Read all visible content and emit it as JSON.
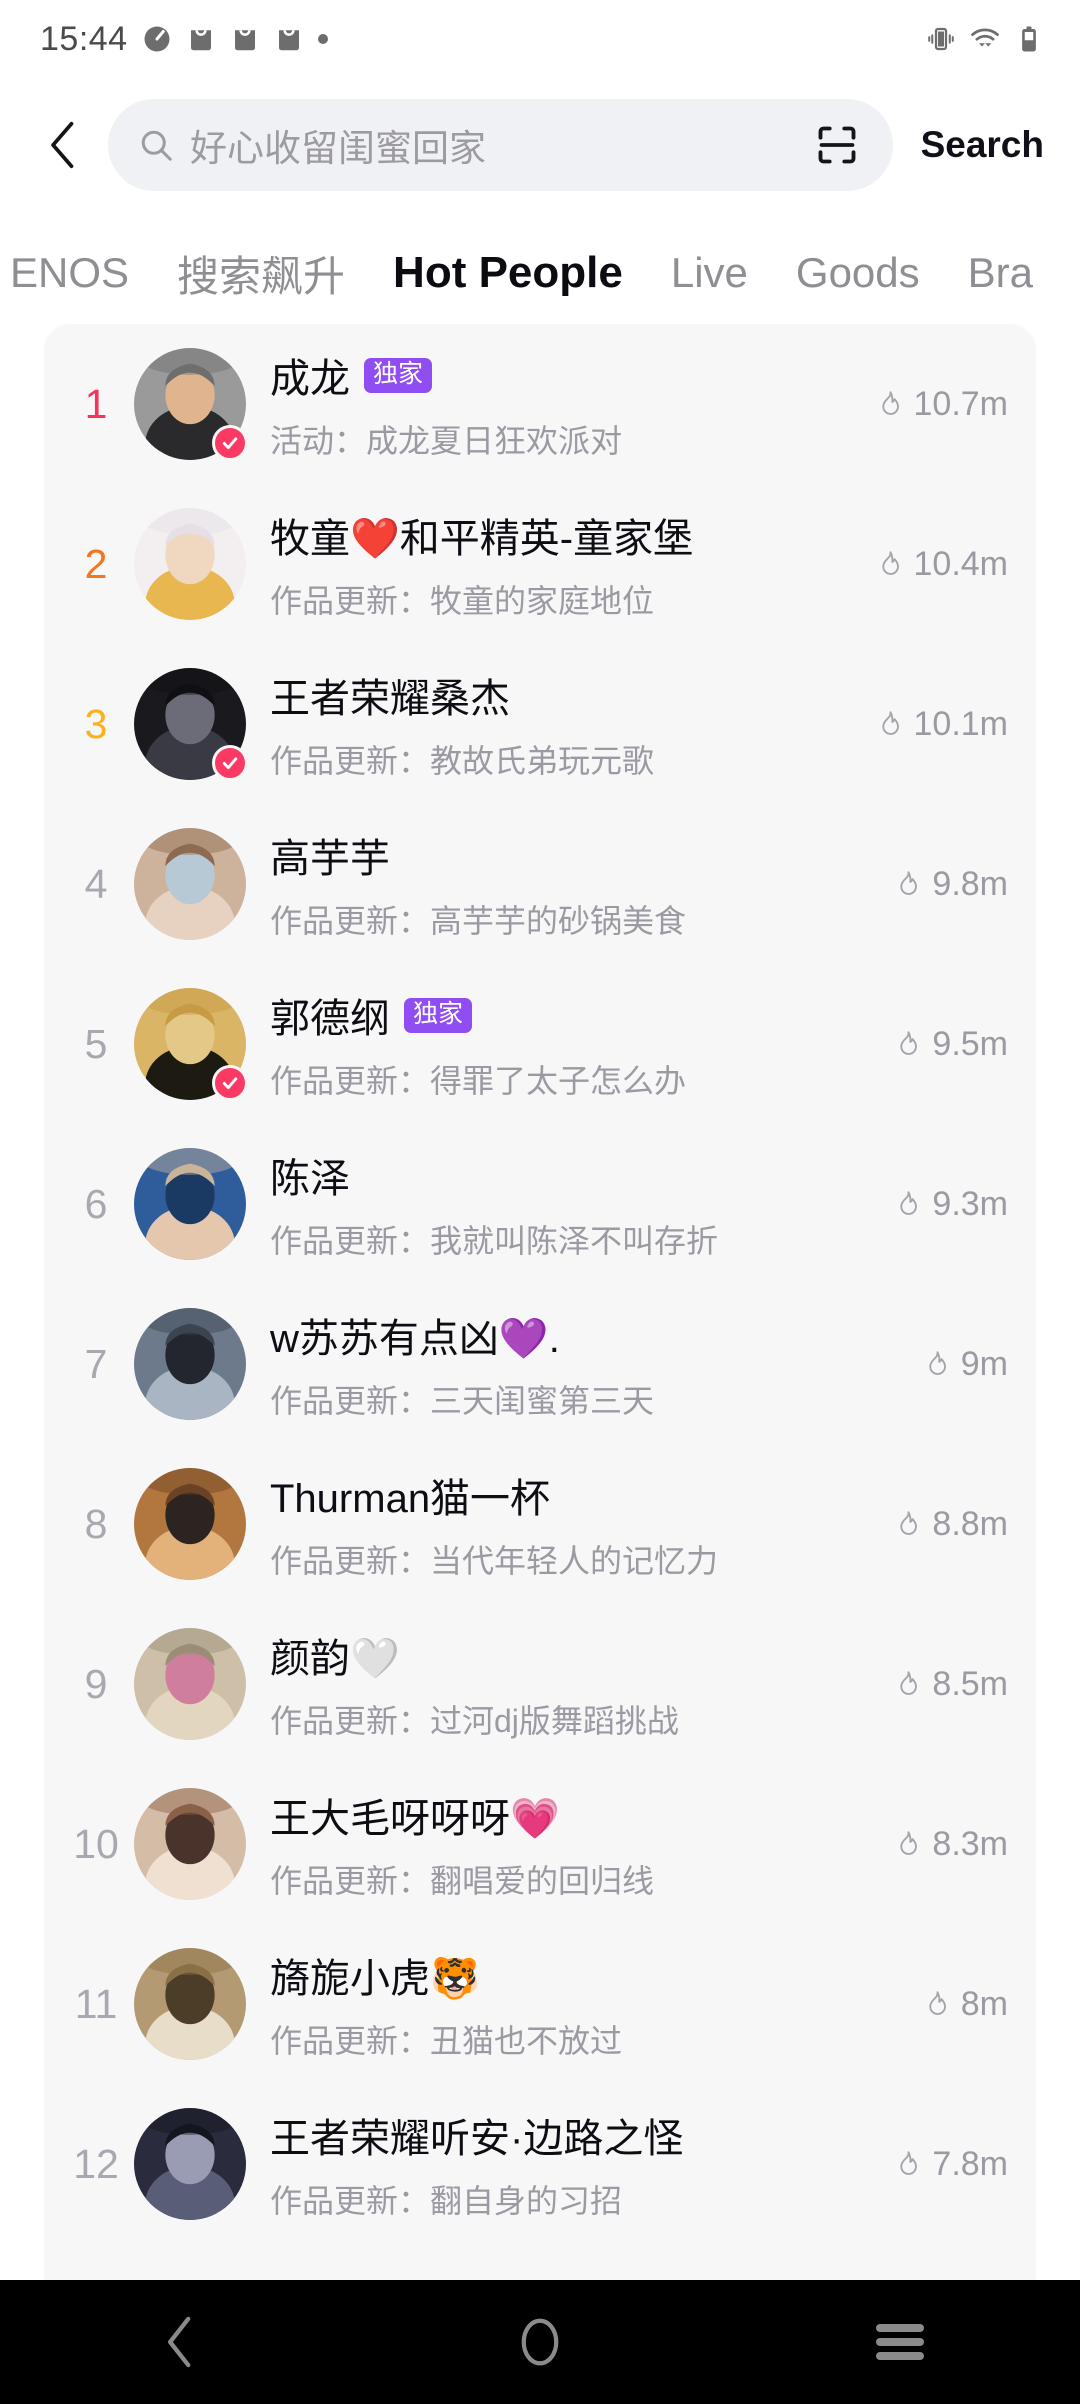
{
  "status_bar": {
    "time": "15:44",
    "left_icons": [
      "speedometer-icon",
      "bag-icon",
      "bag-icon",
      "bag-icon",
      "dot-icon"
    ],
    "right_icons": [
      "vibrate-icon",
      "wifi-icon",
      "battery-icon"
    ]
  },
  "header": {
    "back_icon": "chevron-left-icon",
    "search_icon": "search-icon",
    "search_value": "好心收留闺蜜回家",
    "search_placeholder": "好心收留闺蜜回家",
    "scan_icon": "scan-icon",
    "search_button": "Search"
  },
  "tabs": [
    {
      "label": "ENOS",
      "active": false
    },
    {
      "label": "搜索飙升",
      "active": false
    },
    {
      "label": "Hot People",
      "active": true
    },
    {
      "label": "Live",
      "active": false
    },
    {
      "label": "Goods",
      "active": false
    },
    {
      "label": "Bra",
      "active": false
    }
  ],
  "colors": {
    "rank1": "#f5335e",
    "rank2": "#f4761f",
    "rank3": "#fcb01c",
    "rank_default": "#a8a8b0",
    "badge_exclusive": "#8f4df2",
    "verified": "#fb3a64",
    "card_bg": "#f7f7f8",
    "search_bg": "#f0f1f5"
  },
  "list": {
    "heat_icon": "flame-icon",
    "exclusive_badge_label": "独家",
    "rows": [
      {
        "rank": "1",
        "name": "成龙",
        "badge": "独家",
        "verified": true,
        "subtitle": "活动：成龙夏日狂欢派对",
        "heat": "10.7m",
        "avatar": "jackie-chan-photo"
      },
      {
        "rank": "2",
        "name": "牧童❤️和平精英-童家堡",
        "badge": "",
        "verified": false,
        "subtitle": "作品更新：牧童的家庭地位",
        "heat": "10.4m",
        "avatar": "anime-white-hair"
      },
      {
        "rank": "3",
        "name": "王者荣耀桑杰",
        "badge": "",
        "verified": true,
        "subtitle": "作品更新：教故氏弟玩元歌",
        "heat": "10.1m",
        "avatar": "anime-dark"
      },
      {
        "rank": "4",
        "name": "高芋芋",
        "badge": "",
        "verified": false,
        "subtitle": "作品更新：高芋芋的砂锅美食",
        "heat": "9.8m",
        "avatar": "young-woman-photo"
      },
      {
        "rank": "5",
        "name": "郭德纲",
        "badge": "独家",
        "verified": true,
        "subtitle": "作品更新：得罪了太子怎么办",
        "heat": "9.5m",
        "avatar": "calligraphy-gold"
      },
      {
        "rank": "6",
        "name": "陈泽",
        "badge": "",
        "verified": false,
        "subtitle": "作品更新：我就叫陈泽不叫存折",
        "heat": "9.3m",
        "avatar": "anime-blue-hair"
      },
      {
        "rank": "7",
        "name": "w苏苏有点凶💜.",
        "badge": "",
        "verified": false,
        "subtitle": "作品更新：三天闺蜜第三天",
        "heat": "9m",
        "avatar": "street-photo"
      },
      {
        "rank": "8",
        "name": "Thurman猫一杯",
        "badge": "",
        "verified": false,
        "subtitle": "作品更新：当代年轻人的记忆力",
        "heat": "8.8m",
        "avatar": "sunset-photo"
      },
      {
        "rank": "9",
        "name": "颜韵🤍",
        "badge": "",
        "verified": false,
        "subtitle": "作品更新：过河dj版舞蹈挑战",
        "heat": "8.5m",
        "avatar": "plush-hoodie-photo"
      },
      {
        "rank": "10",
        "name": "王大毛呀呀呀💗",
        "badge": "",
        "verified": false,
        "subtitle": "作品更新：翻唱爱的回归线",
        "heat": "8.3m",
        "avatar": "girl-portrait-photo"
      },
      {
        "rank": "11",
        "name": "旖旎小虎🐯",
        "badge": "",
        "verified": false,
        "subtitle": "作品更新：丑猫也不放过",
        "heat": "8m",
        "avatar": "tabby-cat-photo"
      },
      {
        "rank": "12",
        "name": "王者荣耀听安·边路之怪",
        "badge": "",
        "verified": false,
        "subtitle": "作品更新：翻自身的习招",
        "heat": "7.8m",
        "avatar": "anime-dark-blue"
      }
    ]
  },
  "nav_bar": {
    "back_icon": "nav-back-icon",
    "home_icon": "nav-home-icon",
    "recents_icon": "nav-recents-icon"
  }
}
